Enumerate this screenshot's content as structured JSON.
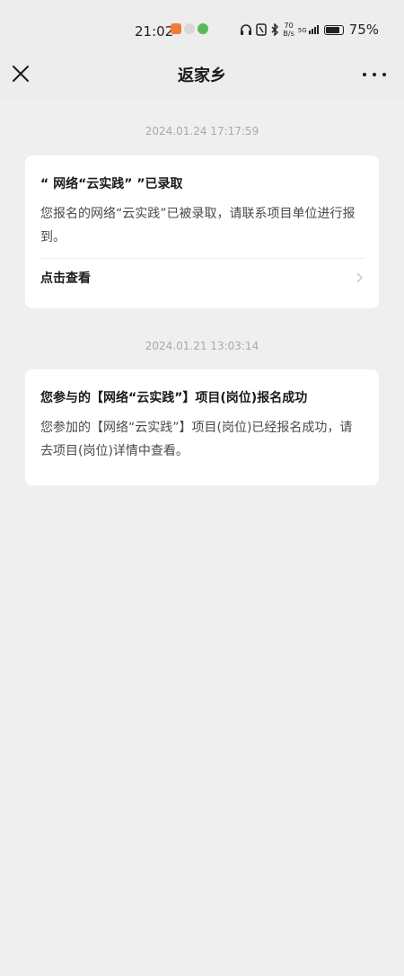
{
  "status": {
    "time": "21:02",
    "network_speed": "70",
    "network_speed_unit": "B/s",
    "signal_label": "5G",
    "battery_percent": "75%",
    "battery_level": 0.75
  },
  "nav": {
    "title": "返家乡"
  },
  "messages": [
    {
      "timestamp": "2024.01.24 17:17:59",
      "title": "“ 网络“云实践” ”已录取",
      "body": "您报名的网络“云实践”已被录取，请联系项目单位进行报到。",
      "link_label": "点击查看"
    },
    {
      "timestamp": "2024.01.21 13:03:14",
      "title": "您参与的【网络“云实践”】项目(岗位)报名成功",
      "body": "您参加的【网络“云实践”】项目(岗位)已经报名成功，请去项目(岗位)详情中查看。"
    }
  ],
  "colors": {
    "background": "#efefef",
    "card": "#ffffff",
    "timestamp": "#a9a9a9"
  }
}
